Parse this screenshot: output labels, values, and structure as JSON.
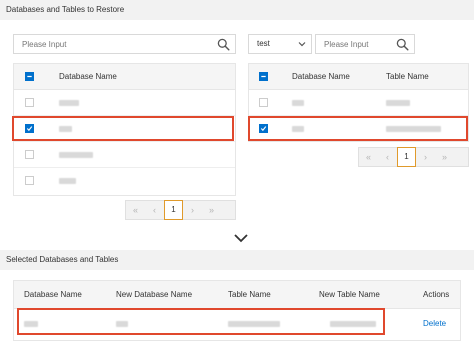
{
  "section1": {
    "title": "Databases and Tables to Restore"
  },
  "left_panel": {
    "search": {
      "placeholder": "Please Input"
    },
    "column_header": "Database Name",
    "rows": [
      {
        "checked": false
      },
      {
        "checked": true
      },
      {
        "checked": false
      },
      {
        "checked": false
      }
    ],
    "pagination": {
      "first": "«",
      "prev": "‹",
      "page": "1",
      "next": "›",
      "last": "»"
    }
  },
  "right_panel": {
    "database_select": {
      "value": "test"
    },
    "search": {
      "placeholder": "Please Input"
    },
    "column_headers": {
      "database": "Database Name",
      "table": "Table Name"
    },
    "rows": [
      {
        "checked": false
      },
      {
        "checked": true
      }
    ],
    "pagination": {
      "first": "«",
      "prev": "‹",
      "page": "1",
      "next": "›",
      "last": "»"
    }
  },
  "section2": {
    "title": "Selected Databases and Tables"
  },
  "selected_table": {
    "headers": {
      "database_name": "Database Name",
      "new_database_name": "New Database Name",
      "table_name": "Table Name",
      "new_table_name": "New Table Name",
      "actions": "Actions"
    },
    "rows": [
      {
        "action": "Delete"
      }
    ]
  },
  "colors": {
    "accent": "#0070cc",
    "highlight": "#e0482d",
    "current_page_border": "#e09a2b"
  }
}
